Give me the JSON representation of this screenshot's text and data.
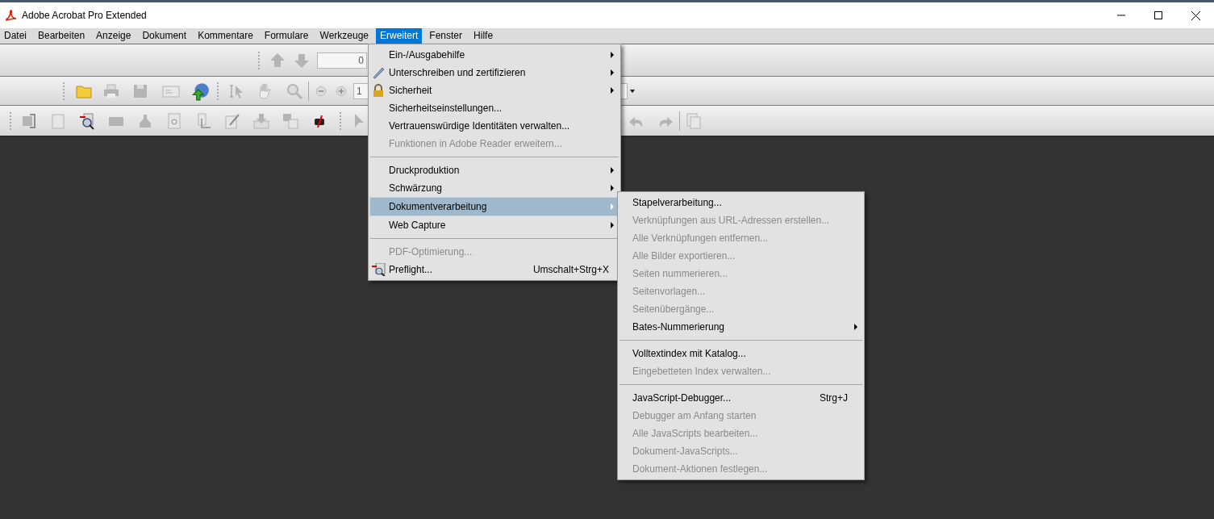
{
  "window": {
    "title": "Adobe Acrobat Pro Extended"
  },
  "menubar": [
    {
      "label": "Datei",
      "selected": false
    },
    {
      "label": "Bearbeiten",
      "selected": false
    },
    {
      "label": "Anzeige",
      "selected": false
    },
    {
      "label": "Dokument",
      "selected": false
    },
    {
      "label": "Kommentare",
      "selected": false
    },
    {
      "label": "Formulare",
      "selected": false
    },
    {
      "label": "Werkzeuge",
      "selected": false
    },
    {
      "label": "Erweitert",
      "selected": true
    },
    {
      "label": "Fenster",
      "selected": false
    },
    {
      "label": "Hilfe",
      "selected": false
    }
  ],
  "toolbar": {
    "page_field": {
      "value": "0"
    },
    "zoom_field": {
      "value": "1"
    }
  },
  "menu": [
    {
      "kind": "item",
      "label": "Ein-/Ausgabehilfe",
      "disabled": false,
      "submenu": true,
      "selected": false
    },
    {
      "kind": "item",
      "label": "Unterschreiben und zertifizieren",
      "disabled": false,
      "submenu": true,
      "selected": false
    },
    {
      "kind": "item",
      "label": "Sicherheit",
      "disabled": false,
      "submenu": true,
      "selected": false
    },
    {
      "kind": "item",
      "label": "Sicherheitseinstellungen...",
      "disabled": false,
      "submenu": false,
      "selected": false
    },
    {
      "kind": "item",
      "label": "Vertrauenswürdige Identitäten verwalten...",
      "disabled": false,
      "submenu": false,
      "selected": false
    },
    {
      "kind": "item",
      "label": "Funktionen in Adobe Reader erweitern...",
      "disabled": true,
      "submenu": false,
      "selected": false
    },
    {
      "kind": "separator"
    },
    {
      "kind": "item",
      "label": "Druckproduktion",
      "disabled": false,
      "submenu": true,
      "selected": false
    },
    {
      "kind": "item",
      "label": "Schwärzung",
      "disabled": false,
      "submenu": true,
      "selected": false
    },
    {
      "kind": "item",
      "label": "Dokumentverarbeitung",
      "disabled": false,
      "submenu": true,
      "selected": true
    },
    {
      "kind": "item",
      "label": "Web Capture",
      "disabled": false,
      "submenu": true,
      "selected": false
    },
    {
      "kind": "separator"
    },
    {
      "kind": "item",
      "label": "PDF-Optimierung...",
      "disabled": true,
      "submenu": false,
      "selected": false
    },
    {
      "kind": "item",
      "label": "Preflight...",
      "disabled": false,
      "submenu": false,
      "selected": false,
      "shortcut": "Umschalt+Strg+X"
    }
  ],
  "submenu": [
    {
      "kind": "item",
      "label": "Stapelverarbeitung...",
      "disabled": false,
      "submenu": false
    },
    {
      "kind": "item",
      "label": "Verknüpfungen aus URL-Adressen erstellen...",
      "disabled": true,
      "submenu": false
    },
    {
      "kind": "item",
      "label": "Alle Verknüpfungen entfernen...",
      "disabled": true,
      "submenu": false
    },
    {
      "kind": "item",
      "label": "Alle Bilder exportieren...",
      "disabled": true,
      "submenu": false
    },
    {
      "kind": "item",
      "label": "Seiten nummerieren...",
      "disabled": true,
      "submenu": false
    },
    {
      "kind": "item",
      "label": "Seitenvorlagen...",
      "disabled": true,
      "submenu": false
    },
    {
      "kind": "item",
      "label": "Seitenübergänge...",
      "disabled": true,
      "submenu": false
    },
    {
      "kind": "item",
      "label": "Bates-Nummerierung",
      "disabled": false,
      "submenu": true
    },
    {
      "kind": "separator"
    },
    {
      "kind": "item",
      "label": "Volltextindex mit Katalog...",
      "disabled": false,
      "submenu": false
    },
    {
      "kind": "item",
      "label": "Eingebetteten Index verwalten...",
      "disabled": true,
      "submenu": false
    },
    {
      "kind": "separator"
    },
    {
      "kind": "item",
      "label": "JavaScript-Debugger...",
      "disabled": false,
      "submenu": false,
      "shortcut": "Strg+J"
    },
    {
      "kind": "item",
      "label": "Debugger am Anfang starten",
      "disabled": true,
      "submenu": false
    },
    {
      "kind": "item",
      "label": "Alle JavaScripts bearbeiten...",
      "disabled": true,
      "submenu": false
    },
    {
      "kind": "item",
      "label": "Dokument-JavaScripts...",
      "disabled": true,
      "submenu": false
    },
    {
      "kind": "item",
      "label": "Dokument-Aktionen festlegen...",
      "disabled": true,
      "submenu": false
    }
  ]
}
